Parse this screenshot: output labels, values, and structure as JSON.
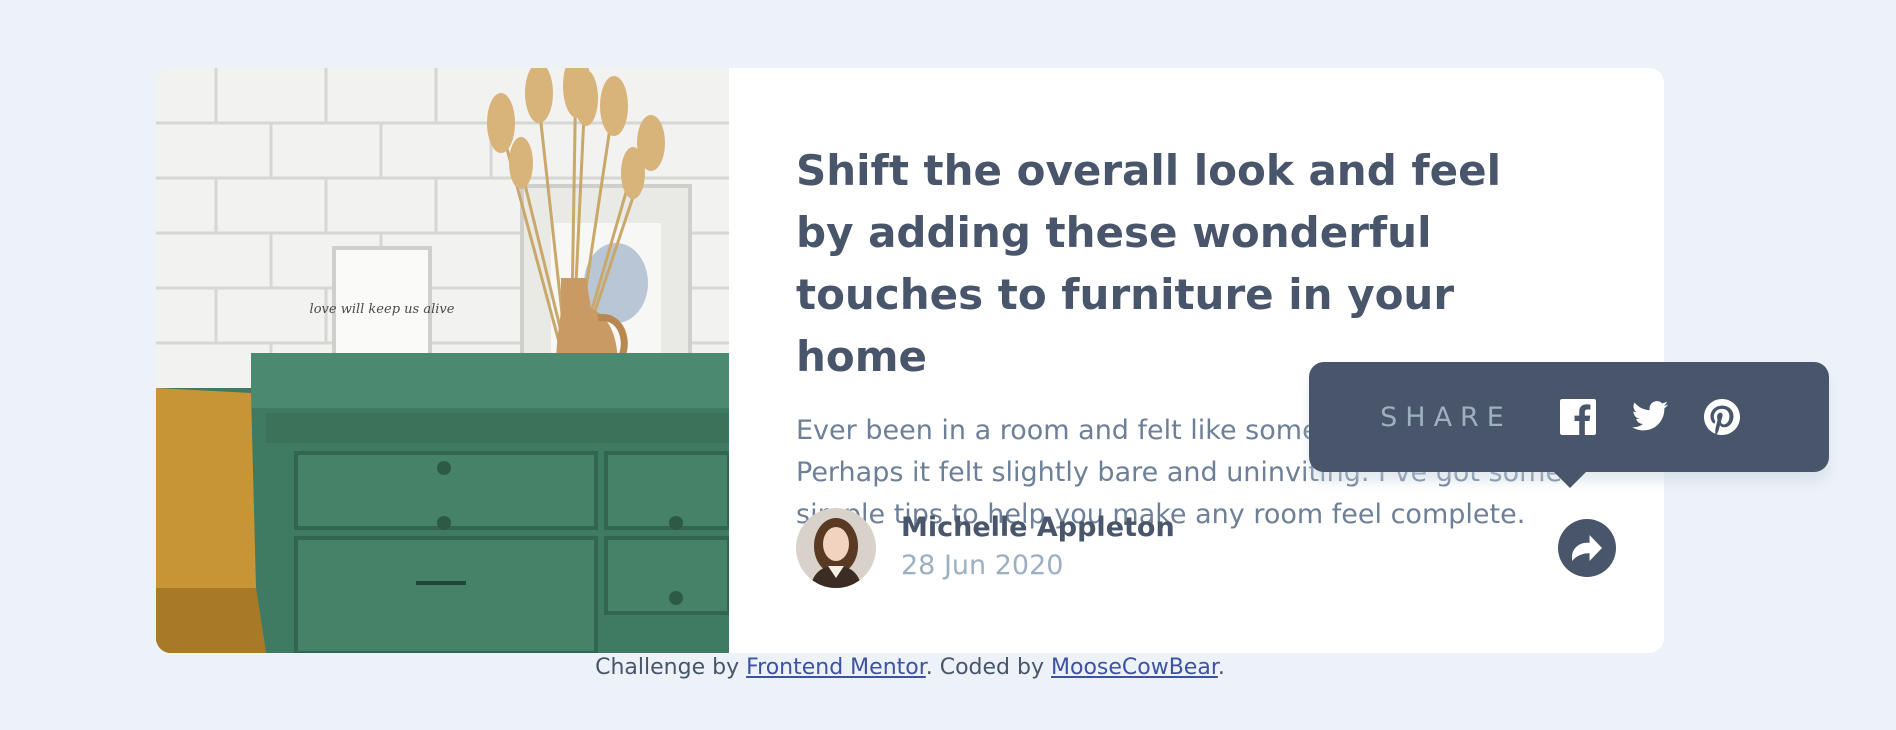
{
  "article": {
    "title": "Shift the overall look and feel by adding these wonderful touches to furniture in your home",
    "description": "Ever been in a room and felt like something was missing? Perhaps it felt slightly bare and uninviting. I’ve got some simple tips to help you make any room feel complete.",
    "author_name": "Michelle Appleton",
    "date": "28 Jun 2020",
    "photo_frame_text": "love will keep us alive"
  },
  "share": {
    "label": "SHARE",
    "icons": [
      "facebook-icon",
      "twitter-icon",
      "pinterest-icon"
    ]
  },
  "footer": {
    "prefix": "Challenge by ",
    "link1": "Frontend Mentor",
    "middle": ". Coded by ",
    "link2": "MooseCowBear",
    "suffix": "."
  },
  "colors": {
    "background": "#ecf2f8",
    "dark": "#48556a",
    "muted": "#6e8098",
    "light": "#9eafc2"
  }
}
